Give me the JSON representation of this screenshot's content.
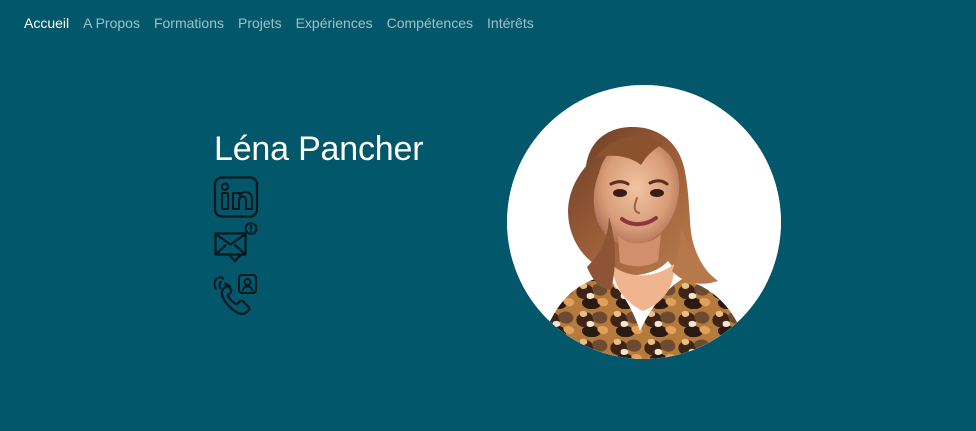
{
  "nav": {
    "items": [
      {
        "label": "Accueil",
        "active": true
      },
      {
        "label": "A Propos",
        "active": false
      },
      {
        "label": "Formations",
        "active": false
      },
      {
        "label": "Projets",
        "active": false
      },
      {
        "label": "Expériences",
        "active": false
      },
      {
        "label": "Compétences",
        "active": false
      },
      {
        "label": "Intérêts",
        "active": false
      }
    ]
  },
  "hero": {
    "name": "Léna Pancher",
    "social": [
      {
        "icon": "linkedin-icon"
      },
      {
        "icon": "email-alert-icon"
      },
      {
        "icon": "phone-contact-icon"
      }
    ],
    "photo": {
      "icon": "profile-photo"
    }
  },
  "theme": {
    "background": "#02586a",
    "text": "#ffffff",
    "muted_nav_text": "rgba(255,255,255,0.62)",
    "icon_stroke": "#071821"
  }
}
